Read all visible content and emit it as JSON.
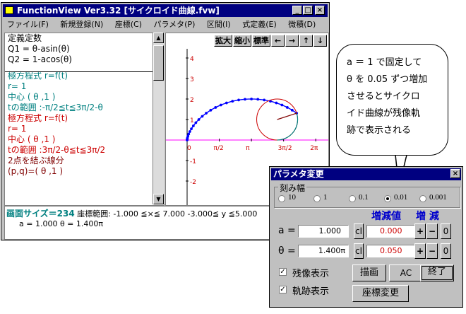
{
  "window": {
    "title": "FunctionView  Ver3.32   [サイクロイド曲線.fvw]",
    "controls": [
      "_",
      "□",
      "×"
    ]
  },
  "menu": [
    "ファイル(F)",
    "新規登録(N)",
    "座標(C)",
    "パラメタ(P)",
    "区間(I)",
    "式定義(E)",
    "微積(D)"
  ],
  "left_lines": [
    {
      "text": "定義定数",
      "color": "#000000"
    },
    {
      "text": "Q1 =  θ-asin(θ)",
      "color": "#000000"
    },
    {
      "text": "Q2 =  1-acos(θ)",
      "color": "#000000"
    },
    {
      "text": "",
      "color": "#000000"
    },
    {
      "text": "極方程式 r=f(t)",
      "color": "#008080"
    },
    {
      "text": " r=   1",
      "color": "#008080"
    },
    {
      "text": "中心 ( θ ,1 )",
      "color": "#008080"
    },
    {
      "text": "tの範囲 :-π/2≦t≦3π/2-θ",
      "color": "#008080"
    },
    {
      "text": "",
      "color": "#000000"
    },
    {
      "text": "極方程式 r=f(t)",
      "color": "#cc0000"
    },
    {
      "text": " r=   1",
      "color": "#cc0000"
    },
    {
      "text": "中心 ( θ ,1 )",
      "color": "#cc0000"
    },
    {
      "text": "tの範囲 :3π/2-θ≦t≦3π/2",
      "color": "#cc0000"
    },
    {
      "text": "",
      "color": "#000000"
    },
    {
      "text": "2点を結ぶ線分",
      "color": "#800000"
    },
    {
      "text": "(p,q)=( θ ,1 )",
      "color": "#800000"
    }
  ],
  "plot_toolbar": [
    "拡大",
    "縮小",
    "標準",
    "←",
    "→",
    "↑",
    "↓"
  ],
  "plot": {
    "y_ticks": [
      "4",
      "3",
      "2",
      "1",
      "-1",
      "-2"
    ],
    "x_ticks": [
      "0",
      "π/2",
      "π",
      "3π/2",
      "2π"
    ]
  },
  "status": {
    "line1_label": "画面サイズ＝234",
    "line1_text": " 座標範囲:  -1.000 ≦×≦ 7.000   -3.000≦ y ≦5.000",
    "line2": "a = 1.000  θ = 1.400π"
  },
  "bubble": [
    "a ＝ 1 で固定して",
    "θ を 0.05 ずつ増加",
    "させるとサイクロ",
    "イド曲線が残像軌",
    "跡で表示される"
  ],
  "dialog": {
    "title": "パラメタ変更",
    "close": "×",
    "step_label": "刻み幅",
    "steps": [
      "10",
      "1",
      "0.1",
      "0.01",
      "0.001"
    ],
    "step_selected": "0.01",
    "head_value": "増減値",
    "head_inc": "増 減",
    "a_label": "a =",
    "a_value": "1.000",
    "a_step": "0.000",
    "theta_label": "θ =",
    "theta_value": "1.400π",
    "theta_step": "0.050",
    "cl": "cl",
    "plus": "+",
    "minus": "−",
    "zero": "0",
    "check_afterimage": "残像表示",
    "check_trace": "軌跡表示",
    "btn_draw": "描画",
    "btn_ac": "AC",
    "btn_end": "終了",
    "btn_coord": "座標変更",
    "check_mark": "✓"
  },
  "colors": {
    "title_bg": "#000080",
    "curve": "#0000ff",
    "circle": "#cc0000",
    "tangent": "#008080",
    "radius": "#800000",
    "axis_x": "#ff00ff"
  }
}
